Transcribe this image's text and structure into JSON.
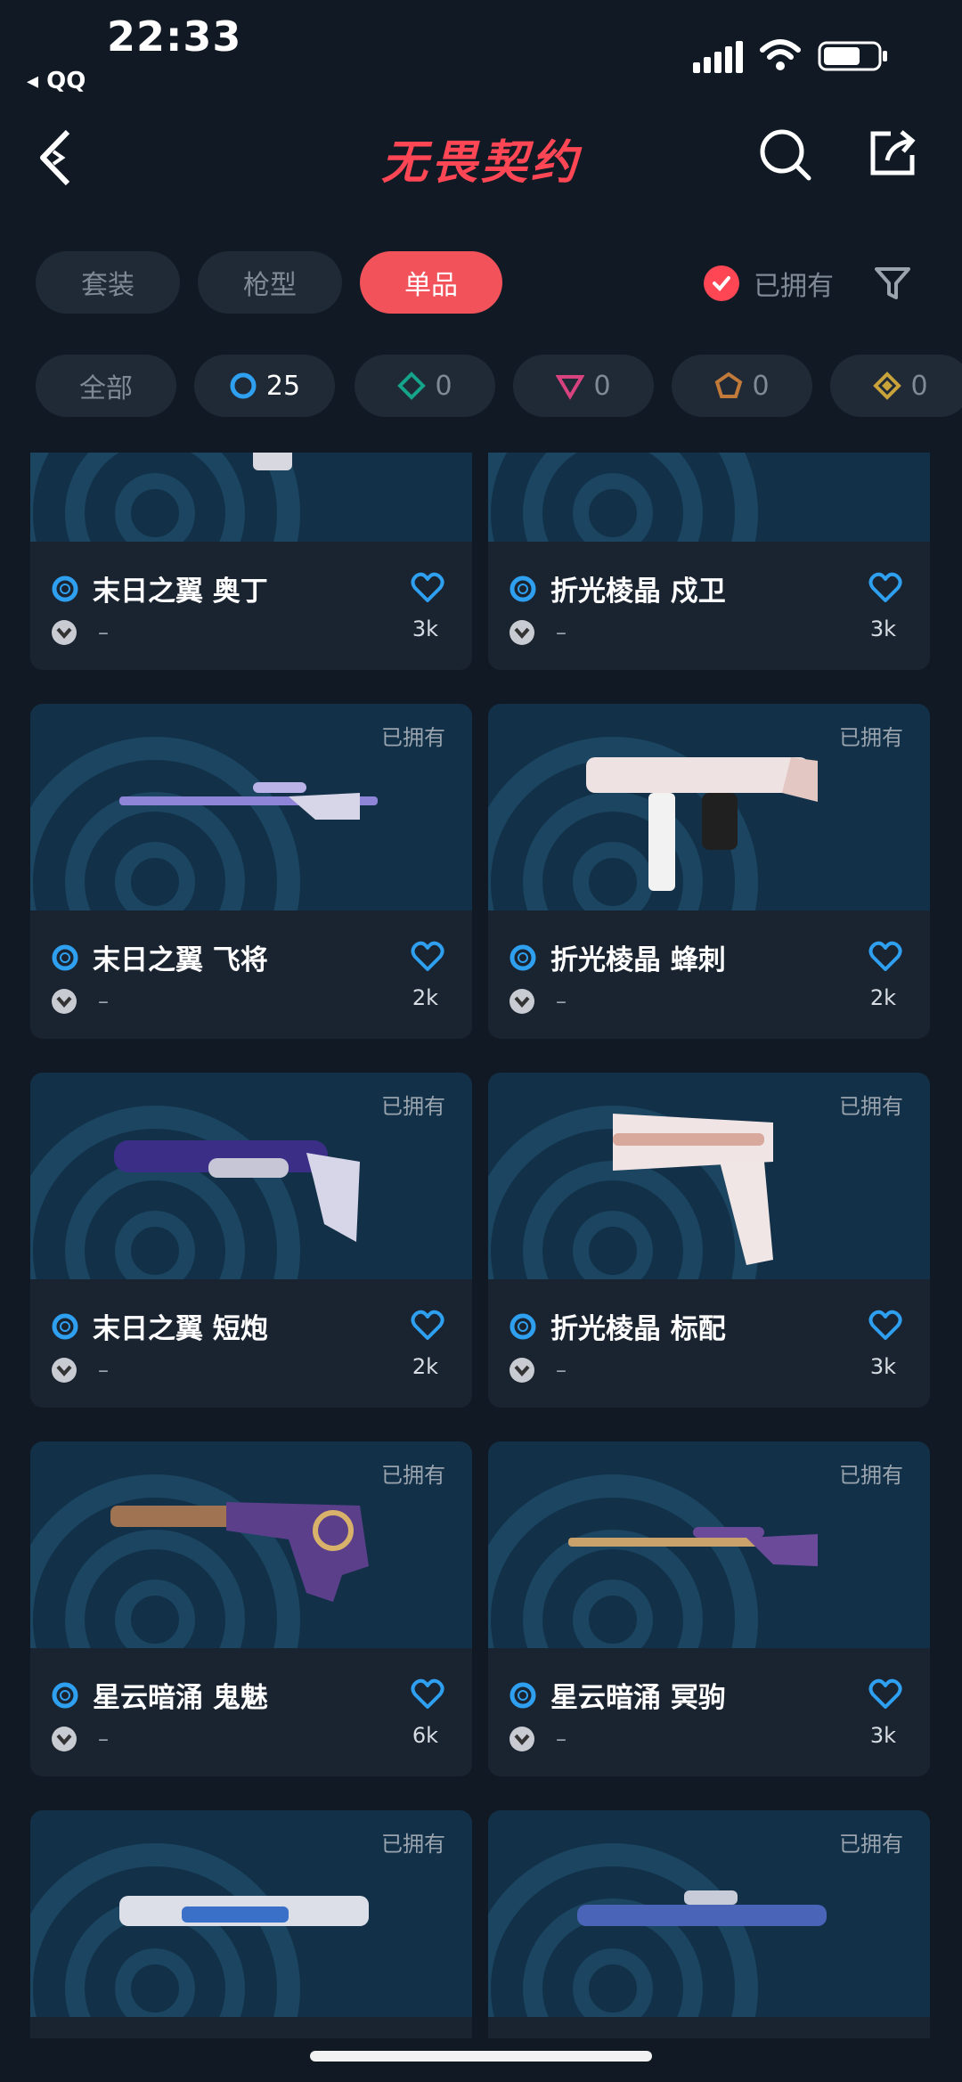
{
  "status_bar": {
    "time": "22:33",
    "back_app": "◂ QQ"
  },
  "header": {
    "title": "无畏契约"
  },
  "tabs": [
    {
      "label": "套装",
      "active": false
    },
    {
      "label": "枪型",
      "active": false
    },
    {
      "label": "单品",
      "active": true
    }
  ],
  "owned_filter": {
    "label": "已拥有",
    "checked": true
  },
  "rarity_chips": [
    {
      "label": "全部",
      "icon": "all"
    },
    {
      "count": "25",
      "icon": "rarity-blue-icon",
      "color": "#2f9ff0"
    },
    {
      "count": "0",
      "icon": "rarity-teal-icon",
      "color": "#15a38a"
    },
    {
      "count": "0",
      "icon": "rarity-pink-icon",
      "color": "#d8427f"
    },
    {
      "count": "0",
      "icon": "rarity-orange-icon",
      "color": "#c27a3a"
    },
    {
      "count": "0",
      "icon": "rarity-gold-icon",
      "color": "#c9a23a"
    }
  ],
  "owned_tag": "已拥有",
  "items": [
    {
      "name": "末日之翼 奥丁",
      "level": "–",
      "likes": "3k",
      "owned": "已拥有"
    },
    {
      "name": "折光棱晶 戍卫",
      "level": "–",
      "likes": "3k",
      "owned": "已拥有"
    },
    {
      "name": "末日之翼 飞将",
      "level": "–",
      "likes": "2k",
      "owned": "已拥有"
    },
    {
      "name": "折光棱晶 蜂刺",
      "level": "–",
      "likes": "2k",
      "owned": "已拥有"
    },
    {
      "name": "末日之翼 短炮",
      "level": "–",
      "likes": "2k",
      "owned": "已拥有"
    },
    {
      "name": "折光棱晶 标配",
      "level": "–",
      "likes": "3k",
      "owned": "已拥有"
    },
    {
      "name": "星云暗涌 鬼魅",
      "level": "–",
      "likes": "6k",
      "owned": "已拥有"
    },
    {
      "name": "星云暗涌 冥驹",
      "level": "–",
      "likes": "3k",
      "owned": "已拥有"
    },
    {
      "name": "",
      "level": "",
      "likes": "",
      "owned": "已拥有"
    },
    {
      "name": "",
      "level": "",
      "likes": "",
      "owned": "已拥有"
    }
  ]
}
